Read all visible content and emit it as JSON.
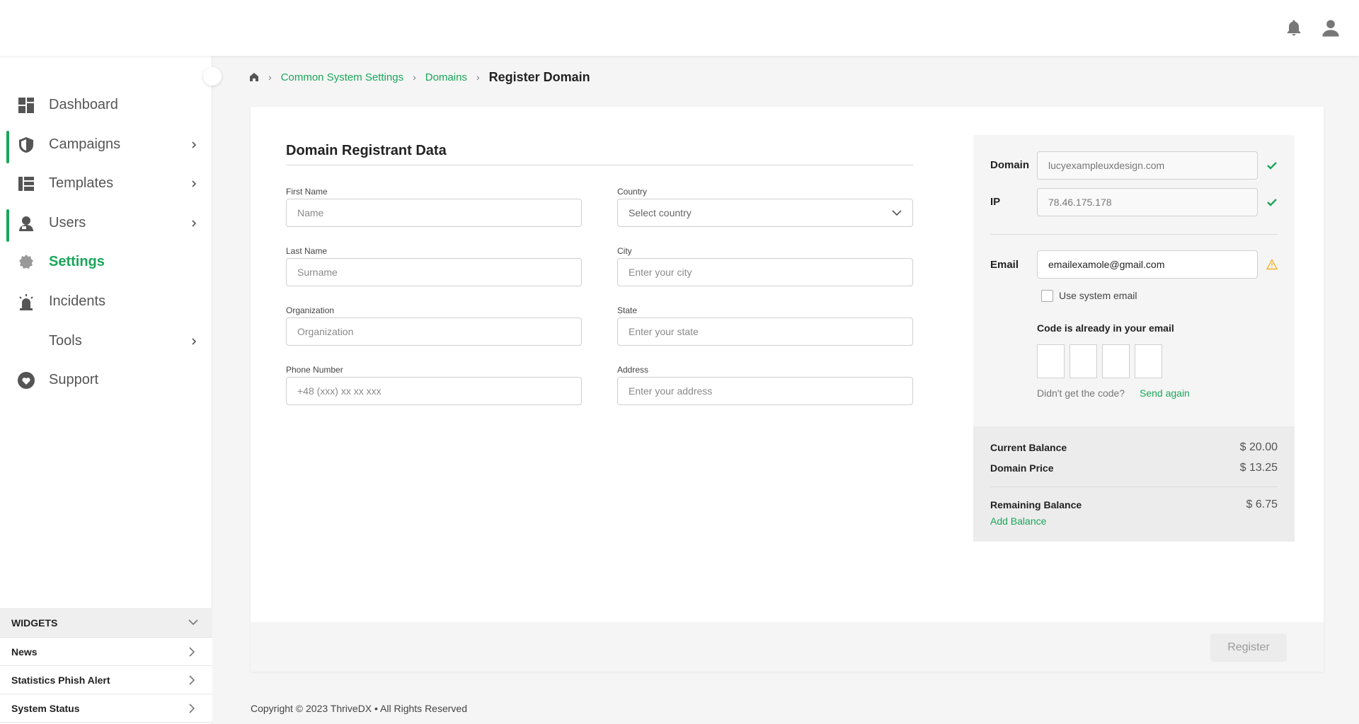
{
  "breadcrumb": {
    "items": [
      "Common System Settings",
      "Domains"
    ],
    "current": "Register Domain"
  },
  "sidebar": {
    "items": [
      {
        "label": "Dashboard",
        "icon": "dashboard-icon",
        "active": false,
        "accent": false,
        "chevron": false
      },
      {
        "label": "Campaigns",
        "icon": "shield-icon",
        "active": false,
        "accent": true,
        "chevron": true
      },
      {
        "label": "Templates",
        "icon": "templates-icon",
        "active": false,
        "accent": false,
        "chevron": true
      },
      {
        "label": "Users",
        "icon": "users-icon",
        "active": false,
        "accent": true,
        "chevron": true
      },
      {
        "label": "Settings",
        "icon": "gear-icon",
        "active": true,
        "accent": false,
        "chevron": false
      },
      {
        "label": "Incidents",
        "icon": "siren-icon",
        "active": false,
        "accent": false,
        "chevron": false
      },
      {
        "label": "Tools",
        "icon": "",
        "active": false,
        "accent": false,
        "chevron": true
      },
      {
        "label": "Support",
        "icon": "heart-icon",
        "active": false,
        "accent": false,
        "chevron": false
      }
    ]
  },
  "widgets": {
    "title": "WIDGETS",
    "items": [
      "News",
      "Statistics Phish Alert",
      "System Status"
    ]
  },
  "form": {
    "title": "Domain Registrant Data",
    "first_name": {
      "label": "First Name",
      "placeholder": "Name"
    },
    "last_name": {
      "label": "Last Name",
      "placeholder": "Surname"
    },
    "organization": {
      "label": "Organization",
      "placeholder": "Organization"
    },
    "phone": {
      "label": "Phone Number",
      "placeholder": "+48 (xxx) xx xx xxx"
    },
    "country": {
      "label": "Country",
      "placeholder": "Select country"
    },
    "city": {
      "label": "City",
      "placeholder": "Enter your city"
    },
    "state": {
      "label": "State",
      "placeholder": "Enter your state"
    },
    "address": {
      "label": "Address",
      "placeholder": "Enter your address"
    }
  },
  "panel": {
    "domain_label": "Domain",
    "domain_value": "lucyexampleuxdesign.com",
    "ip_label": "IP",
    "ip_value": "78.46.175.178",
    "email_label": "Email",
    "email_value": "emailexamole@gmail.com",
    "use_system_email": "Use system email",
    "code_title": "Code is already in your email",
    "didnt_get": "Didn't get the code?",
    "send_again": "Send again"
  },
  "balance": {
    "current_label": "Current Balance",
    "current_value": "$ 20.00",
    "price_label": "Domain Price",
    "price_value": "$ 13.25",
    "remaining_label": "Remaining Balance",
    "remaining_value": "$ 6.75",
    "add_label": "Add Balance"
  },
  "actions": {
    "register": "Register"
  },
  "footer": {
    "copyright": "Copyright © 2023 ThriveDX • All Rights Reserved"
  },
  "colors": {
    "accent": "#1aa55a",
    "warning": "#f0b429"
  }
}
